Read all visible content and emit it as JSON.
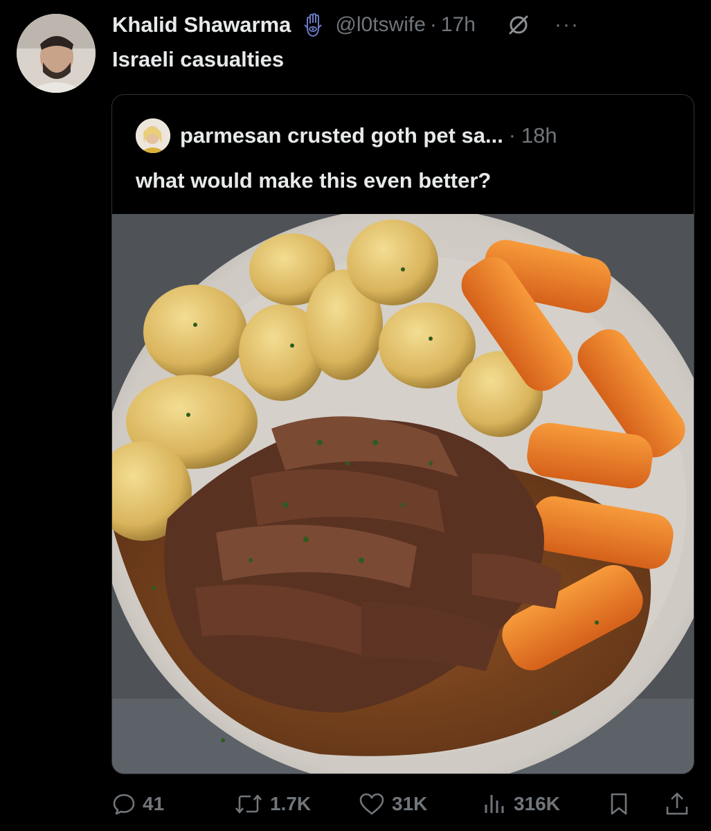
{
  "tweet": {
    "author_name": "Khalid Shawarma",
    "handle": "@l0tswife",
    "separator": "·",
    "time": "17h",
    "text": "Israeli casualties",
    "more_label": "···"
  },
  "quoted": {
    "author_name": "parmesan crusted goth pet sa...",
    "separator": "·",
    "time": "18h",
    "text": "what would make this even better?"
  },
  "actions": {
    "replies": "41",
    "reposts": "1.7K",
    "likes": "31K",
    "views": "316K"
  },
  "colors": {
    "background": "#000000",
    "text": "#e7e9ea",
    "muted": "#71767b",
    "border": "#2f3336"
  }
}
